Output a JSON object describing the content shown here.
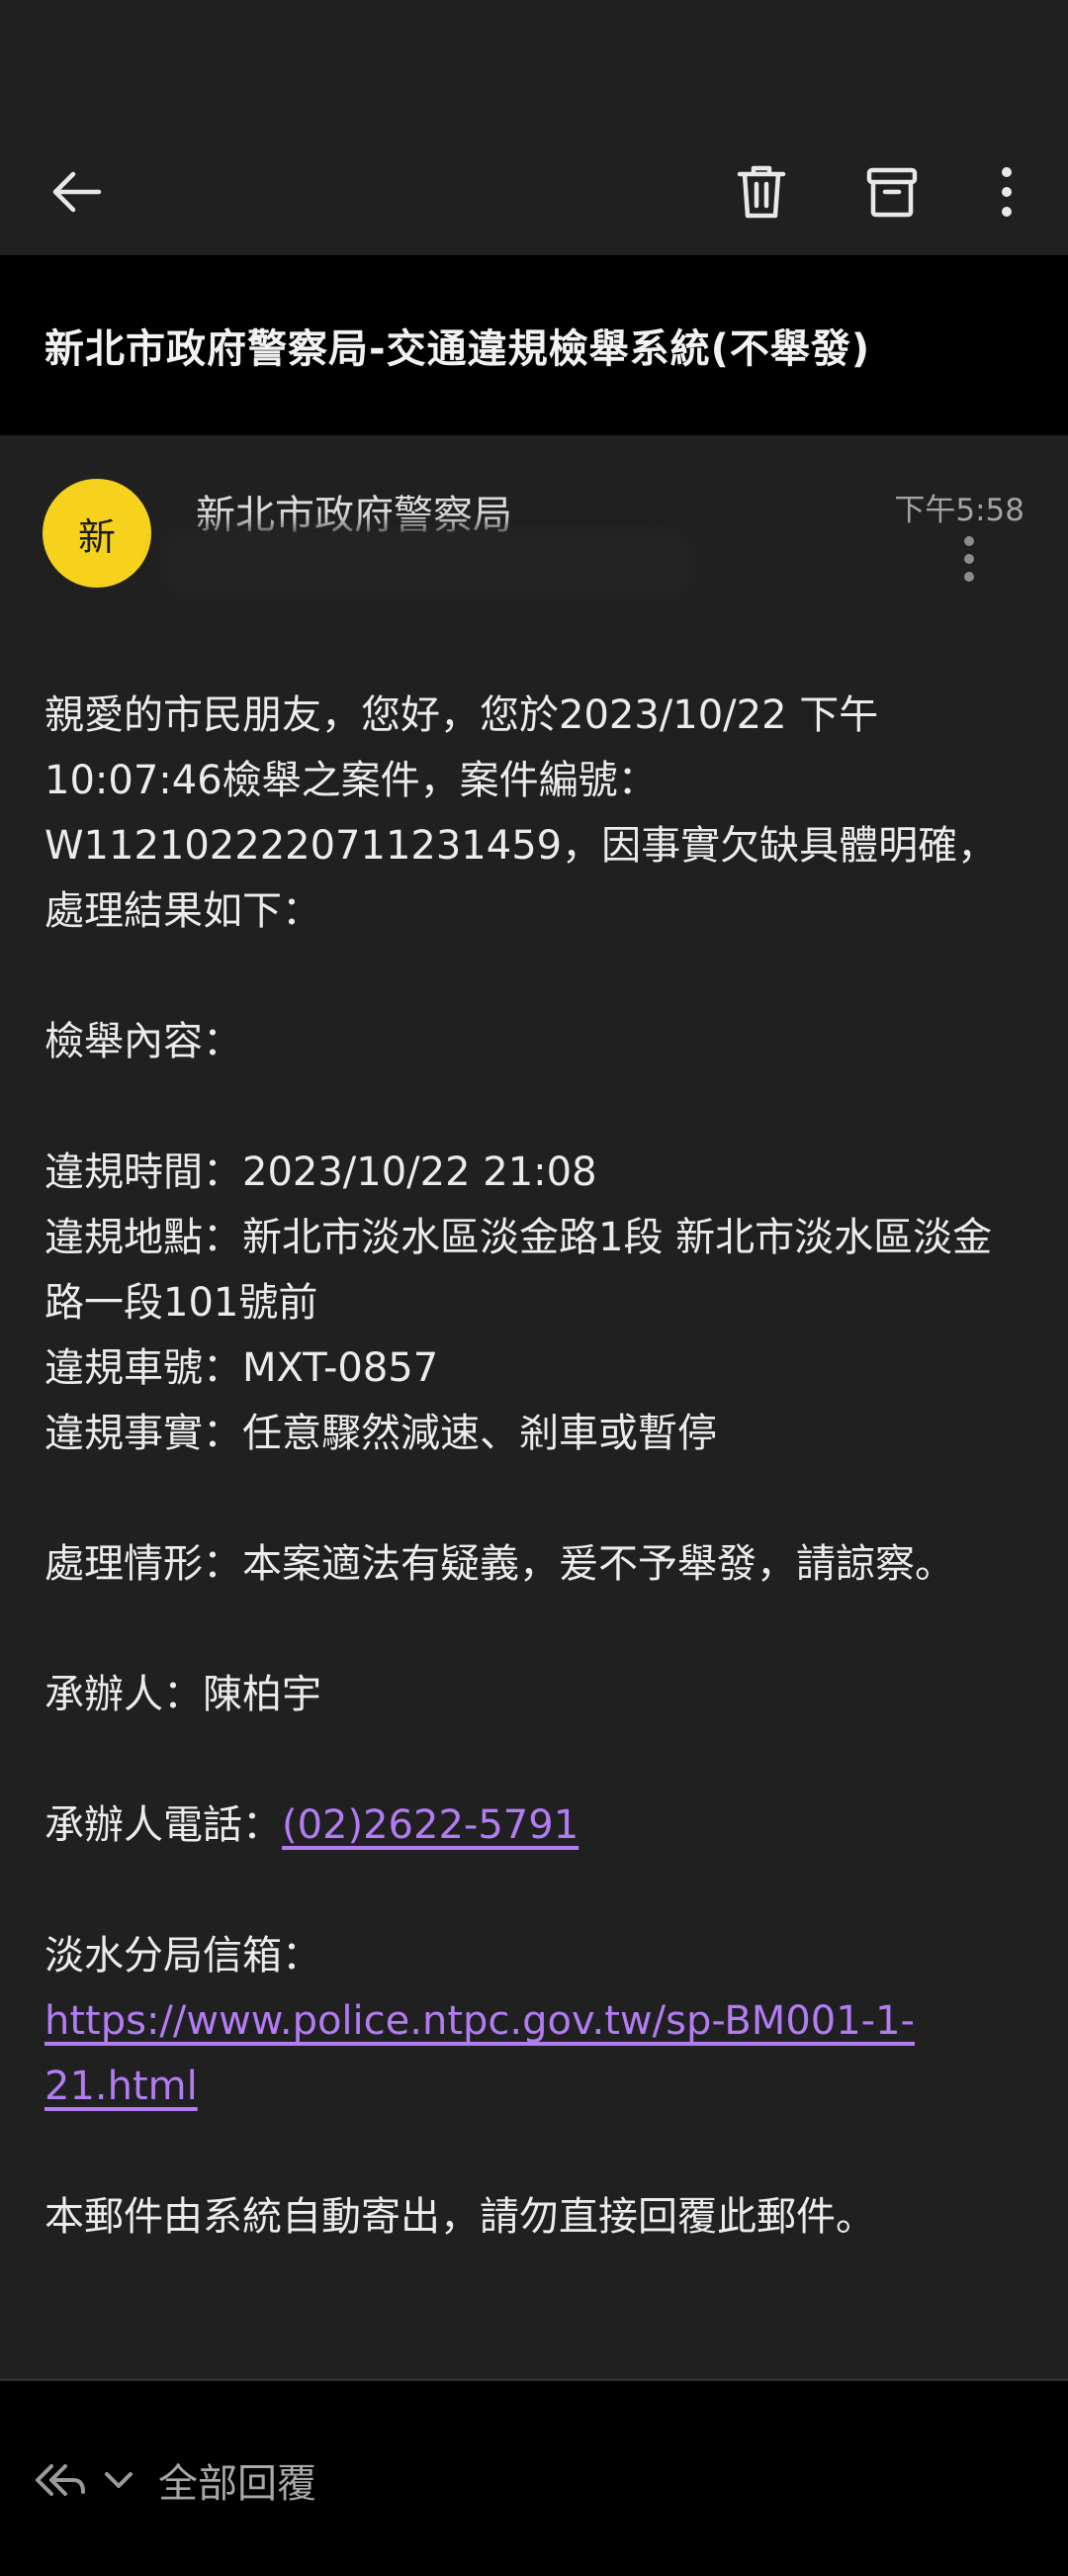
{
  "toolbar": {
    "back_icon": "arrow-left-icon",
    "delete_icon": "trash-icon",
    "archive_icon": "archive-icon",
    "more_icon": "more-vertical-icon"
  },
  "email": {
    "subject": "新北市政府警察局-交通違規檢舉系統(不舉發)",
    "avatar_letter": "新",
    "avatar_color": "#f6d21d",
    "sender": "新北市政府警察局",
    "time": "下午5:58",
    "body": {
      "intro": "親愛的市民朋友，您好，您於2023/10/22 下午 10:07:46檢舉之案件，案件編號：W1121022220711231459，因事實欠缺具體明確，處理結果如下：",
      "content_heading": "檢舉內容：",
      "violation_time": "違規時間：2023/10/22 21:08",
      "violation_place": "違規地點：新北市淡水區淡金路1段 新北市淡水區淡金路一段101號前",
      "plate": "違規車號：MXT-0857",
      "fact": "違規事實：任意驟然減速、剎車或暫停",
      "handling": "處理情形：本案適法有疑義，爰不予舉發，請諒察。",
      "officer": "承辦人：陳柏宇",
      "phone_label": "承辦人電話：",
      "phone": "(02)2622-5791",
      "mailbox_label": "淡水分局信箱：",
      "mailbox_url": "https://www.police.ntpc.gov.tw/sp-BM001-1-21.html",
      "footer": "本郵件由系統自動寄出，請勿直接回覆此郵件。"
    },
    "link_color": "#b27cf2"
  },
  "reply_bar": {
    "icon": "reply-all-icon",
    "dropdown_icon": "chevron-down-icon",
    "label": "全部回覆"
  }
}
